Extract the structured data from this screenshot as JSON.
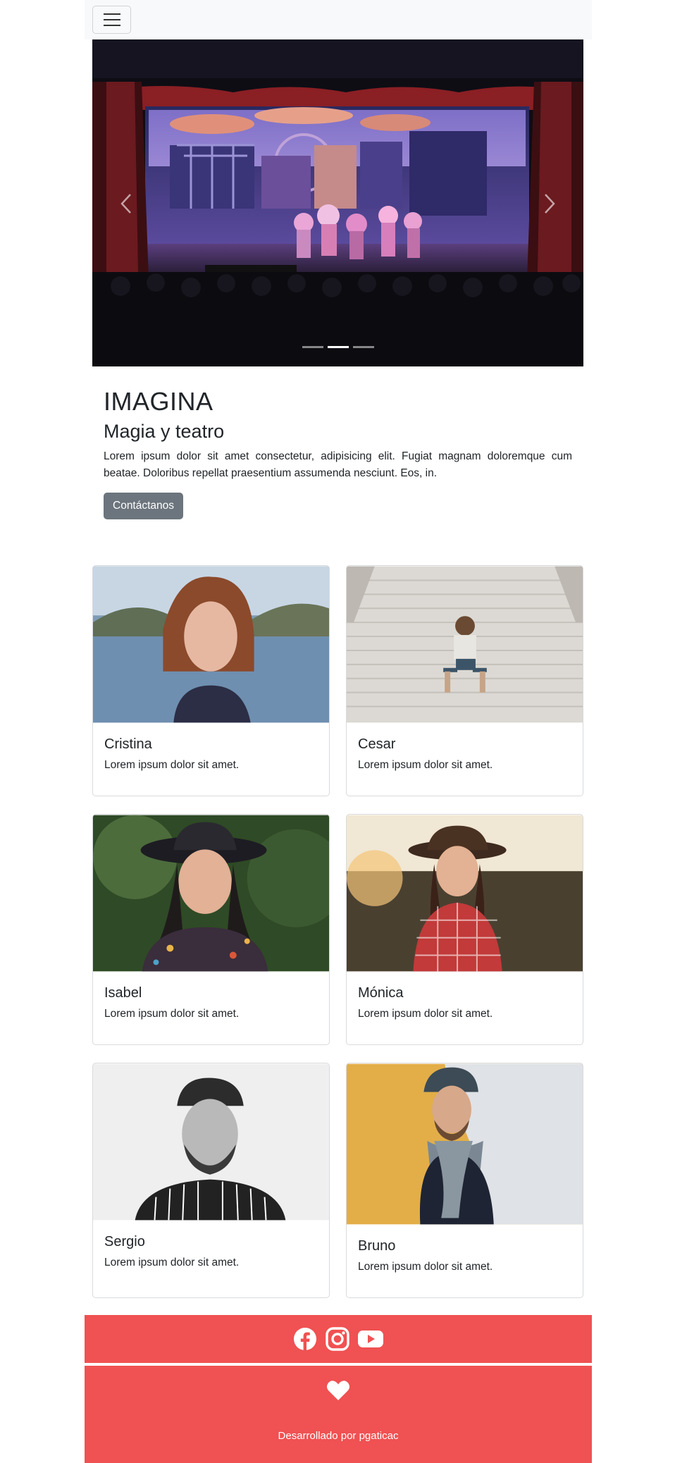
{
  "navbar": {
    "toggle_icon": "hamburger-icon"
  },
  "carousel": {
    "slides": 3,
    "active_slide": 2,
    "prev_icon": "chevron-left-icon",
    "next_icon": "chevron-right-icon"
  },
  "hero": {
    "title": "IMAGINA",
    "subtitle": "Magia y teatro",
    "description": "Lorem ipsum dolor sit amet consectetur, adipisicing elit. Fugiat magnam doloremque cum beatae. Doloribus repellat praesentium assumenda nesciunt. Eos, in.",
    "button": "Contáctanos"
  },
  "team": [
    {
      "name": "Cristina",
      "text": "Lorem ipsum dolor sit amet."
    },
    {
      "name": "Cesar",
      "text": "Lorem ipsum dolor sit amet."
    },
    {
      "name": "Isabel",
      "text": "Lorem ipsum dolor sit amet."
    },
    {
      "name": "Mónica",
      "text": "Lorem ipsum dolor sit amet."
    },
    {
      "name": "Sergio",
      "text": "Lorem ipsum dolor sit amet."
    },
    {
      "name": "Bruno",
      "text": "Lorem ipsum dolor sit amet."
    }
  ],
  "social": {
    "icons": [
      "facebook-icon",
      "instagram-icon",
      "youtube-icon"
    ]
  },
  "footer": {
    "heart_icon": "heart-icon",
    "credit": "Desarrollado por pgaticac"
  },
  "colors": {
    "footer_bg": "#f05152",
    "button_bg": "#6c757d",
    "navbar_bg": "#f8f9fa"
  }
}
